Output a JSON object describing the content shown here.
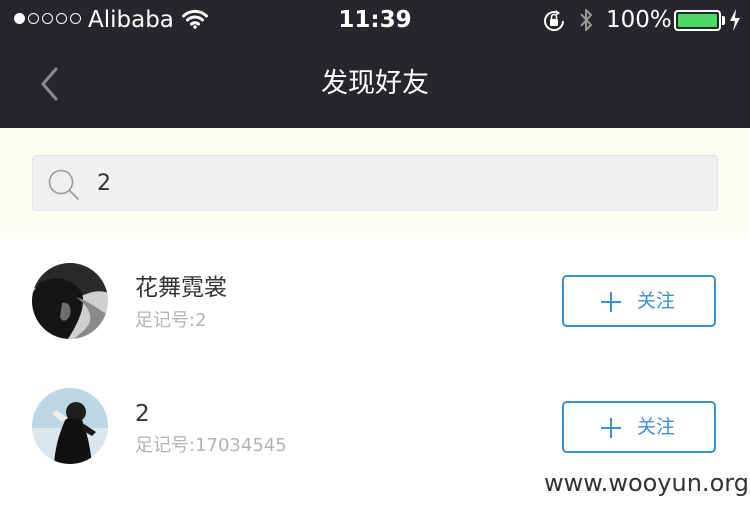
{
  "status_bar": {
    "carrier": "Alibaba",
    "time": "11:39",
    "battery_percent": "100%",
    "signal_bars_filled": 1,
    "signal_bars_total": 5,
    "battery_level": 1.0,
    "icons": [
      "signal-dots-icon",
      "wifi-icon",
      "orientation-lock-icon",
      "bluetooth-icon",
      "battery-icon",
      "charging-bolt-icon"
    ]
  },
  "nav": {
    "title": "发现好友",
    "back_icon": "chevron-left-icon"
  },
  "search": {
    "value": "2",
    "icon": "search-icon"
  },
  "results": [
    {
      "name": "花舞霓裳",
      "id_line": "足记号:2",
      "follow_label": "关注",
      "follow_icon": "plus-icon",
      "avatar": "avatar-photo"
    },
    {
      "name": "2",
      "id_line": "足记号:17034545",
      "follow_label": "关注",
      "follow_icon": "plus-icon",
      "avatar": "avatar-photo"
    }
  ],
  "watermark": "www.wooyun.org",
  "colors": {
    "nav_background": "#25272b",
    "search_area_background": "#fdfcf5",
    "accent": "#3b8fd6",
    "battery_fill": "#4cd964"
  }
}
